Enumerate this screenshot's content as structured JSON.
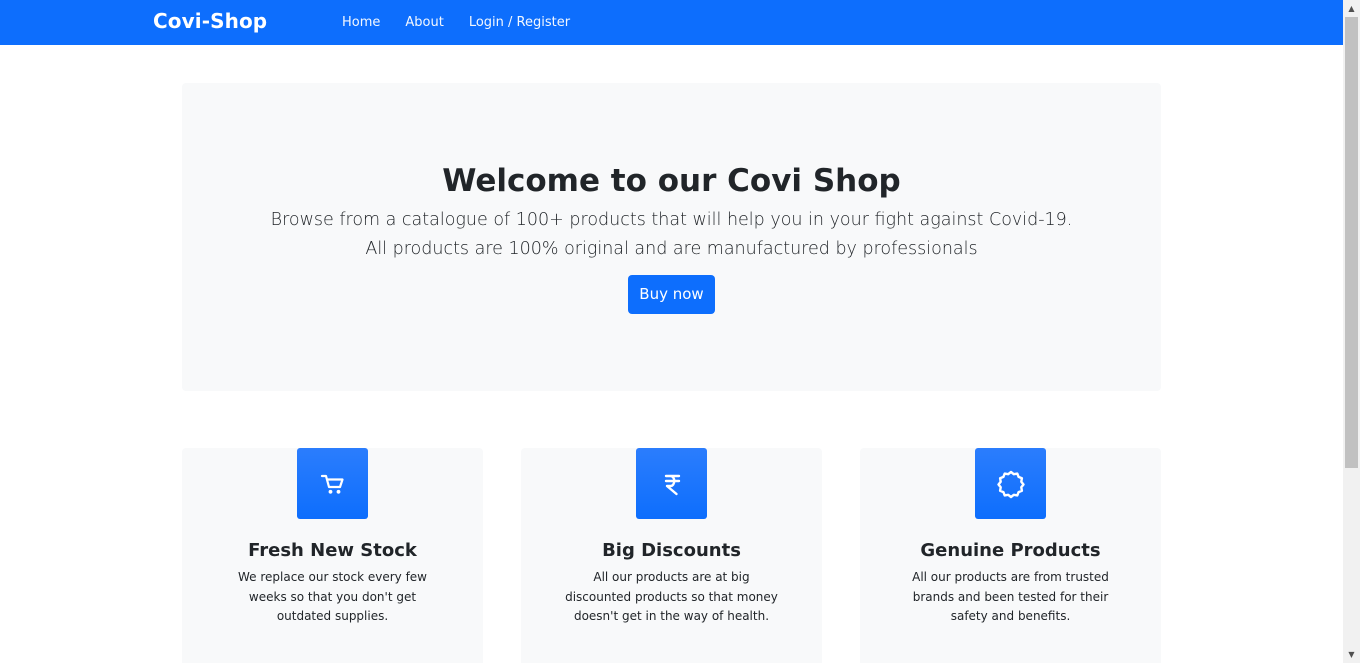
{
  "navbar": {
    "brand": "Covi-Shop",
    "links": [
      "Home",
      "About",
      "Login / Register"
    ],
    "background_color": "#0d6efd"
  },
  "hero": {
    "title": "Welcome to our Covi Shop",
    "subtitle": "Browse from a catalogue of 100+ products that will help you in your fight against Covid-19. All products are 100% original and are manufactured by professionals",
    "button_label": "Buy now"
  },
  "features": [
    {
      "icon": "cart-icon",
      "title": "Fresh New Stock",
      "text": "We replace our stock every few weeks so that you don't get outdated supplies."
    },
    {
      "icon": "rupee-icon",
      "title": "Big Discounts",
      "text": "All our products are at big discounted products so that money doesn't get in the way of health."
    },
    {
      "icon": "badge-icon",
      "title": "Genuine Products",
      "text": "All our products are from trusted brands and been tested for their safety and benefits."
    }
  ],
  "colors": {
    "primary": "#0d6efd",
    "light_bg": "#f8f9fa",
    "text": "#212529"
  }
}
